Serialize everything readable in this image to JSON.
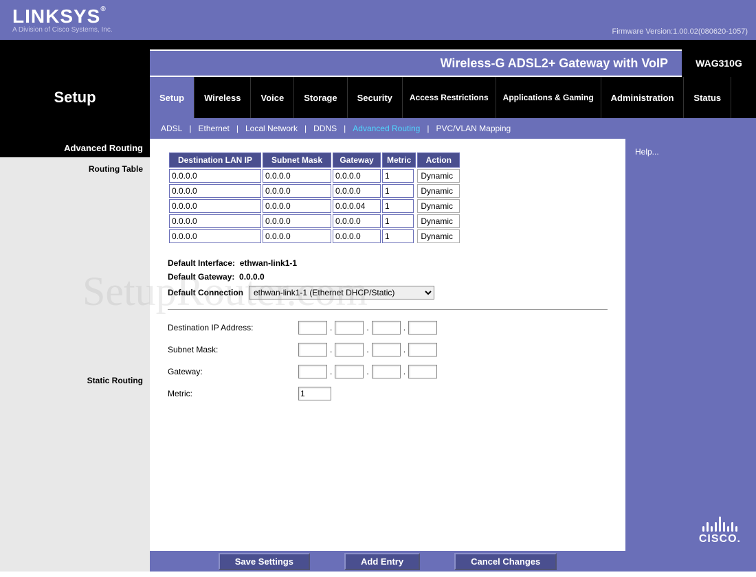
{
  "header": {
    "brand": "LINKSYS",
    "brand_sub": "A Division of Cisco Systems, Inc.",
    "firmware": "Firmware Version:1.00.02(080620-1057)"
  },
  "title": {
    "product": "Wireless-G ADSL2+ Gateway with VoIP",
    "model": "WAG310G"
  },
  "nav": {
    "section": "Setup",
    "tabs": [
      "Setup",
      "Wireless",
      "Voice",
      "Storage",
      "Security",
      "Access Restrictions",
      "Applications & Gaming",
      "Administration",
      "Status"
    ],
    "active": "Setup"
  },
  "subnav": {
    "items": [
      "ADSL",
      "Ethernet",
      "Local Network",
      "DDNS",
      "Advanced Routing",
      "PVC/VLAN Mapping"
    ],
    "active": "Advanced Routing"
  },
  "sidebar": {
    "heading": "Advanced Routing",
    "routing_table": "Routing Table",
    "static_routing": "Static Routing"
  },
  "table": {
    "headers": [
      "Destination LAN IP",
      "Subnet Mask",
      "Gateway",
      "Metric",
      "Action"
    ],
    "rows": [
      {
        "ip": "0.0.0.0",
        "mask": "0.0.0.0",
        "gw": "0.0.0.0",
        "metric": "1",
        "action": "Dynamic"
      },
      {
        "ip": "0.0.0.0",
        "mask": "0.0.0.0",
        "gw": "0.0.0.0",
        "metric": "1",
        "action": "Dynamic"
      },
      {
        "ip": "0.0.0.0",
        "mask": "0.0.0.0",
        "gw": "0.0.0.04",
        "metric": "1",
        "action": "Dynamic"
      },
      {
        "ip": "0.0.0.0",
        "mask": "0.0.0.0",
        "gw": "0.0.0.0",
        "metric": "1",
        "action": "Dynamic"
      },
      {
        "ip": "0.0.0.0",
        "mask": "0.0.0.0",
        "gw": "0.0.0.0",
        "metric": "1",
        "action": "Dynamic"
      }
    ]
  },
  "defaults": {
    "iface_label": "Default Interface:",
    "iface_value": "ethwan-link1-1",
    "gw_label": "Default Gateway:",
    "gw_value": "0.0.0.0",
    "conn_label": "Default Connection",
    "conn_option": "ethwan-link1-1 (Ethernet DHCP/Static)"
  },
  "static": {
    "dest_label": "Destination IP Address:",
    "mask_label": "Subnet Mask:",
    "gw_label": "Gateway:",
    "metric_label": "Metric:",
    "metric_value": "1"
  },
  "buttons": {
    "save": "Save Settings",
    "add": "Add Entry",
    "cancel": "Cancel Changes"
  },
  "help": {
    "link": "Help..."
  },
  "cisco": "CISCO.",
  "watermark": "SetupRouter.com"
}
